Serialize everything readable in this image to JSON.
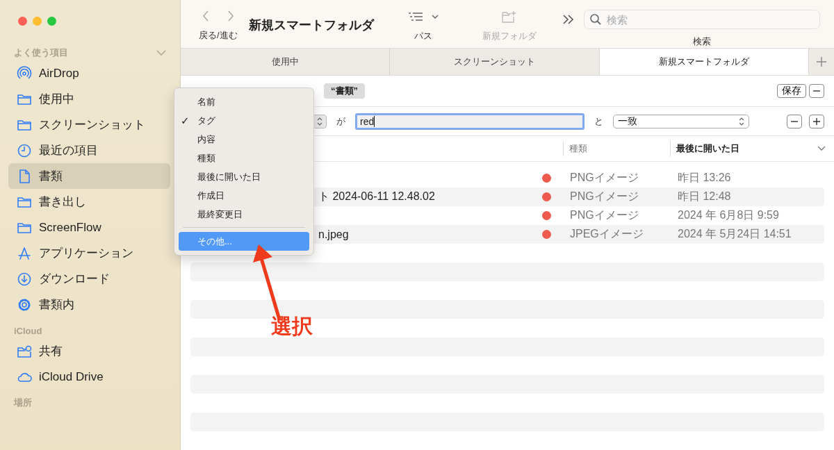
{
  "window": {
    "title": "新規スマートフォルダ"
  },
  "sidebar": {
    "sections": [
      {
        "heading": "よく使う項目",
        "items": [
          {
            "label": "AirDrop",
            "kind": "airdrop",
            "selected": false
          },
          {
            "label": "使用中",
            "kind": "folder",
            "selected": false
          },
          {
            "label": "スクリーンショット",
            "kind": "folder",
            "selected": false
          },
          {
            "label": "最近の項目",
            "kind": "clock",
            "selected": false
          },
          {
            "label": "書類",
            "kind": "doc",
            "selected": true
          },
          {
            "label": "書き出し",
            "kind": "folder",
            "selected": false
          },
          {
            "label": "ScreenFlow",
            "kind": "folder",
            "selected": false
          },
          {
            "label": "アプリケーション",
            "kind": "apps",
            "selected": false
          },
          {
            "label": "ダウンロード",
            "kind": "download",
            "selected": false
          },
          {
            "label": "書類内",
            "kind": "gear",
            "selected": false
          }
        ]
      },
      {
        "heading": "iCloud",
        "items": [
          {
            "label": "共有",
            "kind": "shared",
            "selected": false
          },
          {
            "label": "iCloud Drive",
            "kind": "cloud",
            "selected": false
          }
        ]
      },
      {
        "heading": "場所"
      }
    ]
  },
  "toolbar": {
    "nav_label": "戻る/進む",
    "path_label": "パス",
    "new_folder_label": "新規フォルダ",
    "search_placeholder": "検索",
    "search_label": "検索"
  },
  "tabs": [
    {
      "label": "使用中",
      "selected": false
    },
    {
      "label": "スクリーンショット",
      "selected": false
    },
    {
      "label": "新規スマートフォルダ",
      "selected": true
    }
  ],
  "search_bar": {
    "scope": "“書類”",
    "save": "保存"
  },
  "criteria": {
    "connector": "が",
    "value": "red",
    "and": "と",
    "match": "一致"
  },
  "columns": [
    {
      "label": "種類",
      "sorted": false
    },
    {
      "label": "最後に開いた日",
      "sorted": true
    }
  ],
  "rows": [
    {
      "kind": "PNGイメージ",
      "date": "昨日 13:26"
    },
    {
      "name": "ト 2024-06-11 12.48.02",
      "kind": "PNGイメージ",
      "date": "昨日 12:48"
    },
    {
      "kind": "PNGイメージ",
      "date": "2024 年 6月8日 9:59"
    },
    {
      "name": "n.jpeg",
      "kind": "JPEGイメージ",
      "date": "2024 年 5月24日 14:51"
    }
  ],
  "menu": {
    "items": [
      {
        "label": "名前",
        "checked": false,
        "selected": false
      },
      {
        "label": "タグ",
        "checked": true,
        "selected": false
      },
      {
        "label": "内容",
        "checked": false,
        "selected": false
      },
      {
        "label": "種類",
        "checked": false,
        "selected": false
      },
      {
        "label": "最後に開いた日",
        "checked": false,
        "selected": false
      },
      {
        "label": "作成日",
        "checked": false,
        "selected": false
      },
      {
        "label": "最終変更日",
        "checked": false,
        "selected": false
      },
      {
        "label": "その他...",
        "checked": false,
        "selected": true
      }
    ],
    "check_mark": "✓"
  },
  "annotation": {
    "label": "選択"
  }
}
